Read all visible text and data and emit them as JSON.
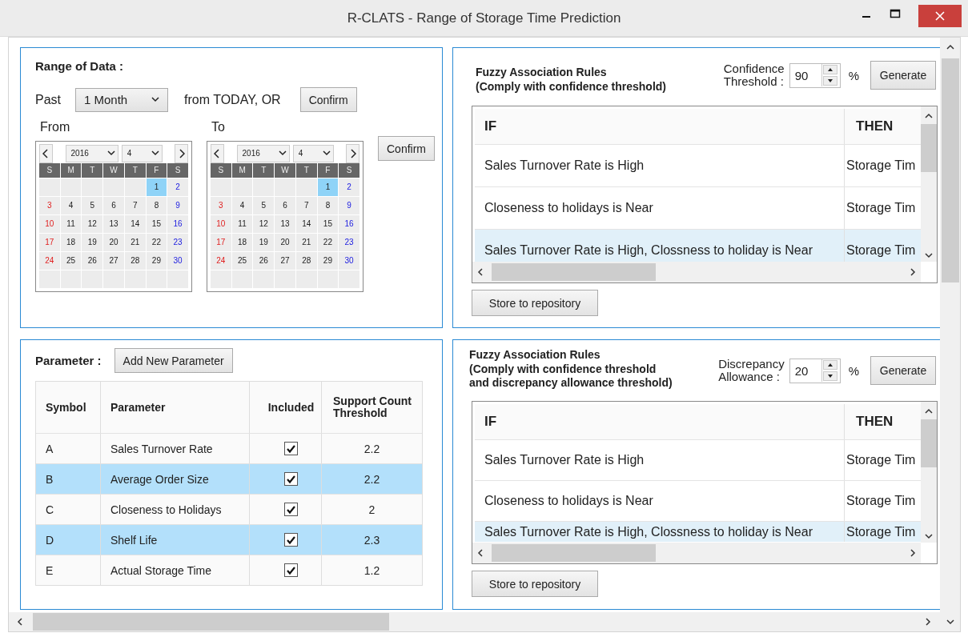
{
  "window": {
    "title": "R-CLATS - Range of Storage Time Prediction"
  },
  "range": {
    "title": "Range of Data :",
    "past_label": "Past",
    "period": "1 Month",
    "from_today": "from TODAY,   OR",
    "confirm_top": "Confirm",
    "from_label": "From",
    "to_label": "To",
    "confirm_calendar": "Confirm",
    "calendars": [
      {
        "year": "2016",
        "month": "4",
        "weekdays": [
          "S",
          "M",
          "T",
          "W",
          "T",
          "F",
          "S"
        ],
        "weeks": [
          [
            {
              "label": "1",
              "selected": true
            },
            {
              "label": "2",
              "selected": false
            }
          ],
          [
            {
              "label": "3",
              "selected": false
            },
            {
              "label": "4",
              "selected": false
            },
            {
              "label": "5",
              "selected": false
            },
            {
              "label": "6",
              "selected": false
            },
            {
              "label": "7",
              "selected": false
            },
            {
              "label": "8",
              "selected": false
            },
            {
              "label": "9",
              "selected": false
            }
          ],
          [
            {
              "label": "10",
              "selected": false
            },
            {
              "label": "11",
              "selected": false
            },
            {
              "label": "12",
              "selected": false
            },
            {
              "label": "13",
              "selected": false
            },
            {
              "label": "14",
              "selected": false
            },
            {
              "label": "15",
              "selected": false
            },
            {
              "label": "16",
              "selected": false
            }
          ],
          [
            {
              "label": "17",
              "selected": false
            },
            {
              "label": "18",
              "selected": false
            },
            {
              "label": "19",
              "selected": false
            },
            {
              "label": "20",
              "selected": false
            },
            {
              "label": "21",
              "selected": false
            },
            {
              "label": "22",
              "selected": false
            },
            {
              "label": "23",
              "selected": false
            }
          ],
          [
            {
              "label": "24",
              "selected": false
            },
            {
              "label": "25",
              "selected": false
            },
            {
              "label": "26",
              "selected": false
            },
            {
              "label": "27",
              "selected": false
            },
            {
              "label": "28",
              "selected": false
            },
            {
              "label": "29",
              "selected": false
            },
            {
              "label": "30",
              "selected": false
            }
          ]
        ]
      },
      {
        "year": "2016",
        "month": "4",
        "weekdays": [
          "S",
          "M",
          "T",
          "W",
          "T",
          "F",
          "S"
        ],
        "weeks": [
          [
            {
              "label": "1",
              "selected": true
            },
            {
              "label": "2",
              "selected": false
            }
          ],
          [
            {
              "label": "3",
              "selected": false
            },
            {
              "label": "4",
              "selected": false
            },
            {
              "label": "5",
              "selected": false
            },
            {
              "label": "6",
              "selected": false
            },
            {
              "label": "7",
              "selected": false
            },
            {
              "label": "8",
              "selected": false
            },
            {
              "label": "9",
              "selected": false
            }
          ],
          [
            {
              "label": "10",
              "selected": false
            },
            {
              "label": "11",
              "selected": false
            },
            {
              "label": "12",
              "selected": false
            },
            {
              "label": "13",
              "selected": false
            },
            {
              "label": "14",
              "selected": false
            },
            {
              "label": "15",
              "selected": false
            },
            {
              "label": "16",
              "selected": false
            }
          ],
          [
            {
              "label": "17",
              "selected": false
            },
            {
              "label": "18",
              "selected": false
            },
            {
              "label": "19",
              "selected": false
            },
            {
              "label": "20",
              "selected": false
            },
            {
              "label": "21",
              "selected": false
            },
            {
              "label": "22",
              "selected": false
            },
            {
              "label": "23",
              "selected": false
            }
          ],
          [
            {
              "label": "24",
              "selected": false
            },
            {
              "label": "25",
              "selected": false
            },
            {
              "label": "26",
              "selected": false
            },
            {
              "label": "27",
              "selected": false
            },
            {
              "label": "28",
              "selected": false
            },
            {
              "label": "29",
              "selected": false
            },
            {
              "label": "30",
              "selected": false
            }
          ]
        ]
      }
    ]
  },
  "parameters": {
    "title": "Parameter :",
    "add_button": "Add New Parameter",
    "columns": [
      "Symbol",
      "Parameter",
      "Included",
      "Support Count Threshold"
    ],
    "rows": [
      {
        "symbol": "A",
        "parameter": "Sales Turnover Rate",
        "included": true,
        "threshold": "2.2",
        "selected": false
      },
      {
        "symbol": "B",
        "parameter": "Average Order Size",
        "included": true,
        "threshold": "2.2",
        "selected": true
      },
      {
        "symbol": "C",
        "parameter": "Closeness to Holidays",
        "included": true,
        "threshold": "2",
        "selected": false
      },
      {
        "symbol": "D",
        "parameter": "Shelf Life",
        "included": true,
        "threshold": "2.3",
        "selected": true
      },
      {
        "symbol": "E",
        "parameter": "Actual Storage Time",
        "included": true,
        "threshold": "1.2",
        "selected": false
      }
    ]
  },
  "rule_panels": [
    {
      "title": "Fuzzy Association Rules\n(Comply with confidence threshold)",
      "spinner_label": "Confidence\nThreshold :",
      "value": "90",
      "unit": "%",
      "generate": "Generate",
      "columns": [
        "IF",
        "THEN"
      ],
      "rows": [
        {
          "if": "Sales Turnover Rate is High",
          "then": "Storage Tim",
          "selected": false
        },
        {
          "if": "Closeness to holidays is Near",
          "then": "Storage Tim",
          "selected": false
        },
        {
          "if": "Sales Turnover Rate is High, Clossness to holiday is Near",
          "then": "Storage Tim",
          "selected": true
        }
      ],
      "store": "Store to repository"
    },
    {
      "title": "Fuzzy Association Rules\n(Comply with confidence threshold\nand discrepancy allowance threshold)",
      "spinner_label": "Discrepancy\nAllowance :",
      "value": "20",
      "unit": "%",
      "generate": "Generate",
      "columns": [
        "IF",
        "THEN"
      ],
      "rows": [
        {
          "if": "Sales Turnover Rate is High",
          "then": "Storage Tim",
          "selected": false
        },
        {
          "if": "Closeness to holidays is Near",
          "then": "Storage Tim",
          "selected": false
        },
        {
          "if": "Sales Turnover Rate is High, Clossness to holiday is Near",
          "then": "Storage Tim",
          "selected": true
        }
      ],
      "store": "Store to repository"
    }
  ]
}
